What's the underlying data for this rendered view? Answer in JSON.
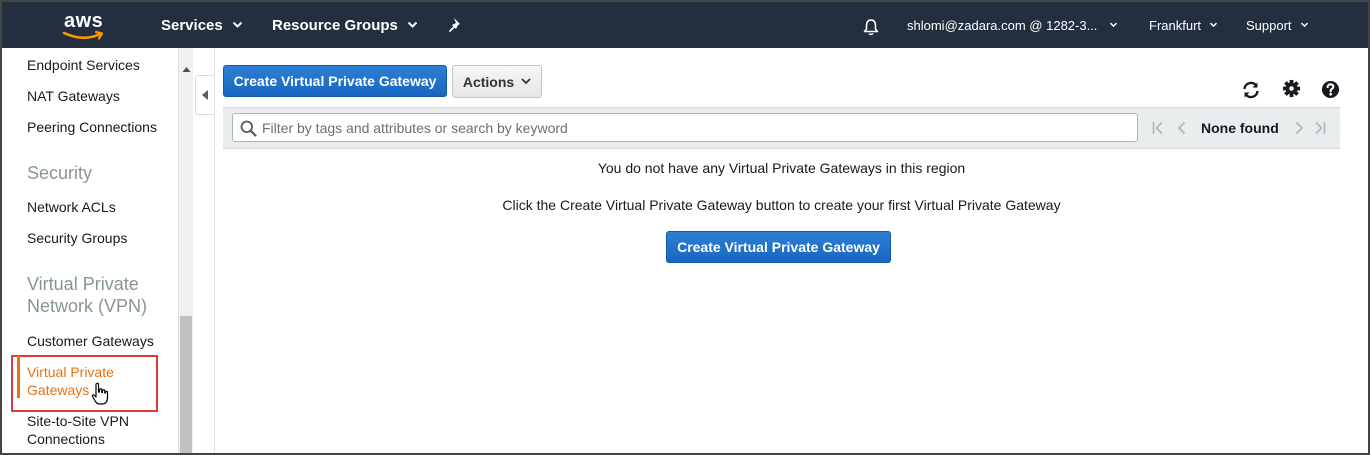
{
  "topnav": {
    "logo_text": "aws",
    "services_label": "Services",
    "resource_groups_label": "Resource Groups",
    "account_label": "shlomi@zadara.com @ 1282-3...",
    "region_label": "Frankfurt",
    "support_label": "Support"
  },
  "sidebar": {
    "partial_top_item": "Endpoint Services",
    "nat_gateways": "NAT Gateways",
    "peering_connections": "Peering Connections",
    "security_heading": "Security",
    "network_acls": "Network ACLs",
    "security_groups": "Security Groups",
    "vpn_heading_line1": "Virtual Private",
    "vpn_heading_line2": "Network (VPN)",
    "customer_gateways": "Customer Gateways",
    "virtual_private_gateways_line1": "Virtual Private",
    "virtual_private_gateways_line2": "Gateways",
    "site_to_site_line1": "Site-to-Site VPN",
    "site_to_site_line2": "Connections"
  },
  "toolbar": {
    "create_label": "Create Virtual Private Gateway",
    "actions_label": "Actions"
  },
  "filter": {
    "placeholder": "Filter by tags and attributes or search by keyword",
    "pager_text": "None found"
  },
  "empty_state": {
    "message": "You do not have any Virtual Private Gateways in this region",
    "hint": "Click the Create Virtual Private Gateway button to create your first Virtual Private Gateway",
    "create_label": "Create Virtual Private Gateway"
  },
  "colors": {
    "nav_bg": "#232f3e",
    "primary": "#1a6fc9",
    "active": "#ec7211",
    "highlight": "#e03a3a"
  }
}
